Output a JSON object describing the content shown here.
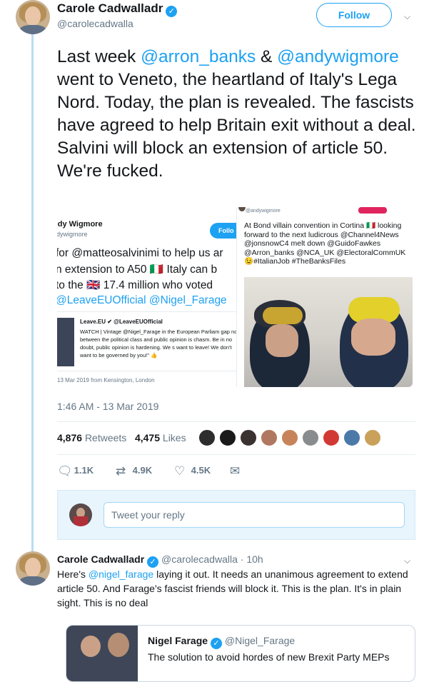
{
  "tweet": {
    "author_name": "Carole Cadwalladr",
    "author_handle": "@carolecadwalla",
    "follow_label": "Follow",
    "text_parts": {
      "p1": "Last week ",
      "m1": "@arron_banks",
      "p2": " & ",
      "m2": "@andywigmore",
      "p3": " went to Veneto, the heartland of Italy's Lega Nord. Today, the plan is revealed. The fascists have agreed to help Britain exit without a deal. Salvini will block an extension of article 50. We're fucked."
    },
    "timestamp": "1:46 AM - 13 Mar 2019",
    "retweets_count": "4,876",
    "retweets_label": "Retweets",
    "likes_count": "4,475",
    "likes_label": "Likes",
    "actions": {
      "reply": "1.1K",
      "retweet": "4.9K",
      "like": "4.5K"
    }
  },
  "media_left": {
    "name": "ndy Wigmore",
    "handle": "ndywigmore",
    "follow": "Follo",
    "line1": "for @matteosalvinimi to help us ar",
    "line2": "n extension to A50 🇮🇹 Italy can b",
    "line3": " to the 🇬🇧 17.4 million who voted",
    "line4": "@LeaveEUOfficial @Nigel_Farage",
    "quote_name": "Leave.EU ✔ @LeaveEUOfficial",
    "quote_text": "WATCH | Vintage @Nigel_Farage in the European Parliam gap now between the political class and public opinion is chasm. Be in no doubt, public opinion is hardening. We s want to leave! We don't want to be governed by you!\" 👍",
    "date": "13 Mar 2019 from Kensington, London"
  },
  "media_right": {
    "top_handle": "@andywigmore",
    "text": "At Bond villain convention in Cortina 🇮🇹 looking forward to the next ludicrous @Channel4News @jonsnowC4 melt down @GuidoFawkes @Arron_banks @NCA_UK @ElectoralCommUK 😉#ItalianJob #TheBanksFiles"
  },
  "reply_box": {
    "placeholder": "Tweet your reply"
  },
  "reply": {
    "author_name": "Carole Cadwalladr",
    "author_handle": "@carolecadwalla",
    "time": "· 10h",
    "text_pre": "Here's ",
    "mention": "@nigel_farage",
    "text_post": " laying it out. It needs an unanimous agreement to extend article 50. And Farage's fascist friends will block it. This is the plan. It's in plain sight. This is no deal"
  },
  "quote": {
    "author_name": "Nigel Farage",
    "author_handle": "@Nigel_Farage",
    "text": "The solution to avoid hordes of new Brexit Party MEPs"
  },
  "colors": {
    "accent": "#1da1f2",
    "text": "#14171a",
    "muted": "#657786"
  }
}
